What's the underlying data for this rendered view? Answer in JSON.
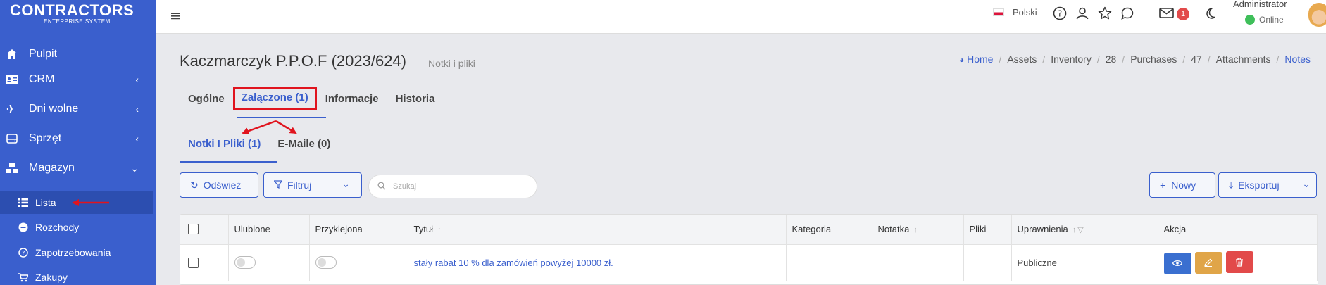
{
  "brand": {
    "title": "CONTRACTORS",
    "subtitle": "ENTERPRISE SYSTEM"
  },
  "sidebar": {
    "items": [
      {
        "label": "Pulpit",
        "icon": "home-icon"
      },
      {
        "label": "CRM",
        "icon": "id-card-icon"
      },
      {
        "label": "Dni wolne",
        "icon": "plane-icon"
      },
      {
        "label": "Sprzęt",
        "icon": "hdd-icon"
      },
      {
        "label": "Magazyn",
        "icon": "boxes-icon"
      }
    ],
    "subitems": [
      {
        "label": "Lista",
        "icon": "list-icon"
      },
      {
        "label": "Rozchody",
        "icon": "minus-circle-icon"
      },
      {
        "label": "Zapotrzebowania",
        "icon": "question-circle-icon"
      },
      {
        "label": "Zakupy",
        "icon": "cart-icon"
      }
    ]
  },
  "topbar": {
    "language": "Polski",
    "mail_count": "1",
    "user_name": "Administrator",
    "user_status": "Online"
  },
  "page": {
    "title": "Kaczmarczyk P.P.O.F (2023/624)",
    "subtitle": "Notki i pliki"
  },
  "breadcrumb": [
    "Home",
    "Assets",
    "Inventory",
    "28",
    "Purchases",
    "47",
    "Attachments",
    "Notes"
  ],
  "tabs": [
    "Ogólne",
    "Załączone (1)",
    "Informacje",
    "Historia"
  ],
  "subtabs": [
    "Notki I Pliki (1)",
    "E-Maile (0)"
  ],
  "toolbar": {
    "refresh": "Odśwież",
    "filter": "Filtruj",
    "search_placeholder": "Szukaj",
    "new": "Nowy",
    "export": "Eksportuj"
  },
  "table": {
    "headers": [
      "Ulubione",
      "Przyklejona",
      "Tytuł",
      "Kategoria",
      "Notatka",
      "Pliki",
      "Uprawnienia",
      "Akcja"
    ],
    "rows": [
      {
        "title": "stały rabat 10 % dla zamówień powyżej 10000 zł.",
        "category": "",
        "note": "",
        "files": "",
        "permissions": "Publiczne"
      }
    ]
  },
  "colors": {
    "sidebar": "#3a5fcd",
    "accent": "#3a5fcd",
    "annotation": "#e0141e"
  }
}
